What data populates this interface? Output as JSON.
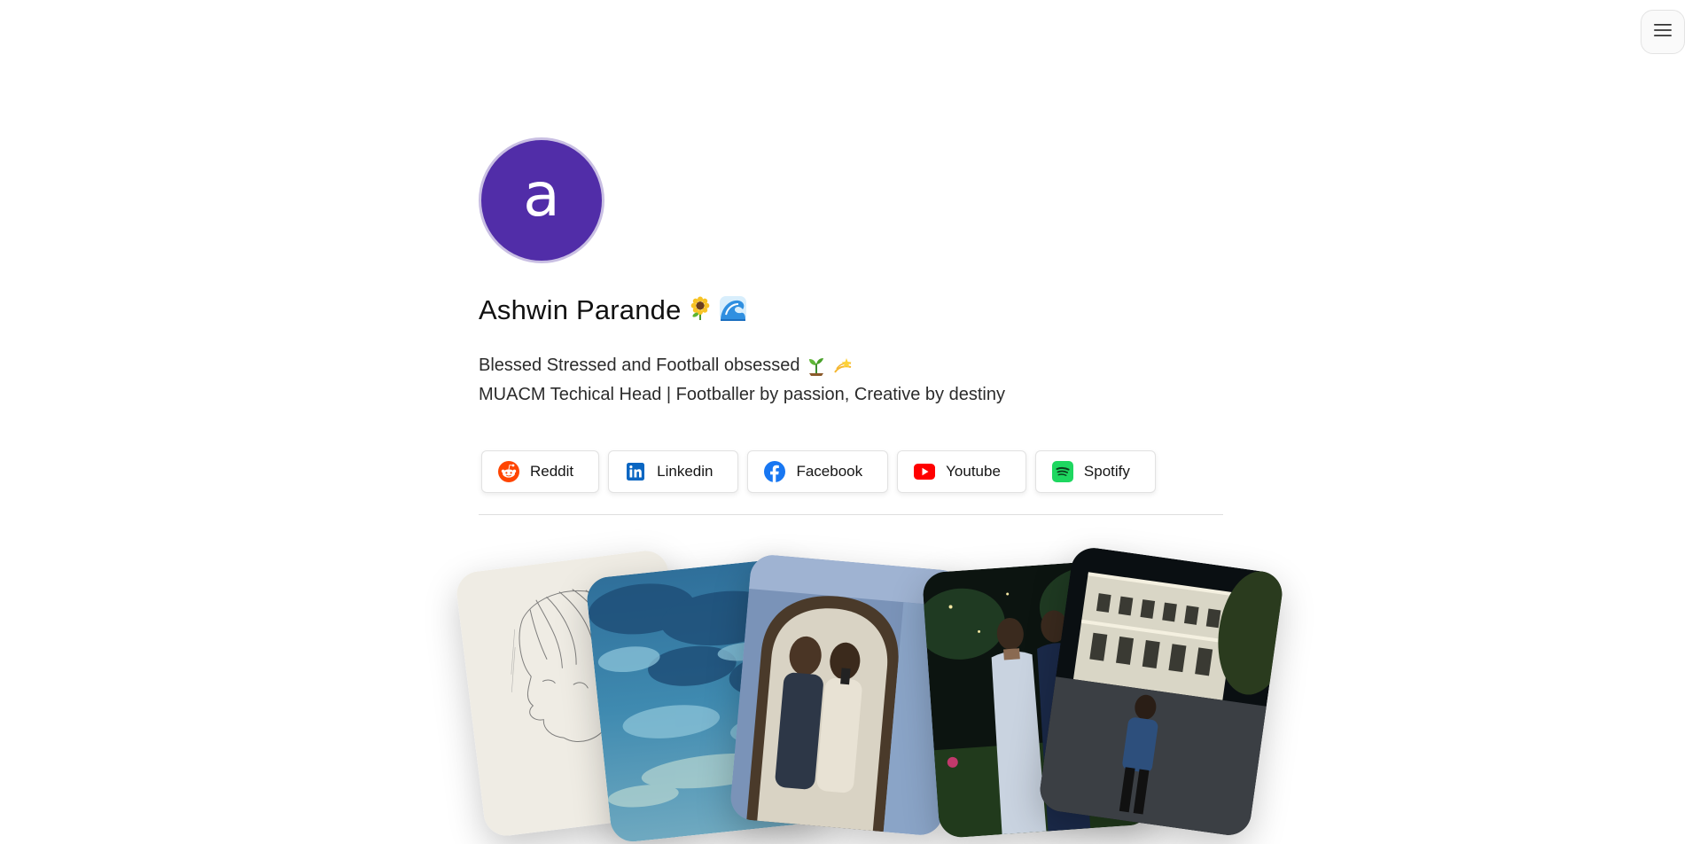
{
  "menu": {
    "icon": "hamburger-menu-icon"
  },
  "profile": {
    "avatar_letter": "a",
    "name": "Ashwin Parande",
    "name_emojis": [
      "sunflower-emoji",
      "water-wave-emoji"
    ],
    "bio_line1": "Blessed Stressed and Football obsessed",
    "bio_line1_emojis": [
      "seedling-emoji",
      "dizzy-emoji"
    ],
    "bio_line2": "MUACM Techical Head | Footballer by passion, Creative by destiny"
  },
  "links": [
    {
      "label": "Reddit",
      "icon": "reddit-icon",
      "color": "#ff4500"
    },
    {
      "label": "Linkedin",
      "icon": "linkedin-icon",
      "color": "#0a66c2"
    },
    {
      "label": "Facebook",
      "icon": "facebook-icon",
      "color": "#1877f2"
    },
    {
      "label": "Youtube",
      "icon": "youtube-icon",
      "color": "#ff0000"
    },
    {
      "label": "Spotify",
      "icon": "spotify-icon",
      "color": "#1ed760"
    }
  ],
  "gallery": [
    {
      "subject": "pencil-sketch-portrait"
    },
    {
      "subject": "cloudy-sky-painting"
    },
    {
      "subject": "mirror-selfie-two-people"
    },
    {
      "subject": "two-people-night-event"
    },
    {
      "subject": "person-in-front-of-lit-palace"
    }
  ],
  "colors": {
    "avatar_bg": "#512da8",
    "avatar_ring": "#c9bfe3"
  }
}
